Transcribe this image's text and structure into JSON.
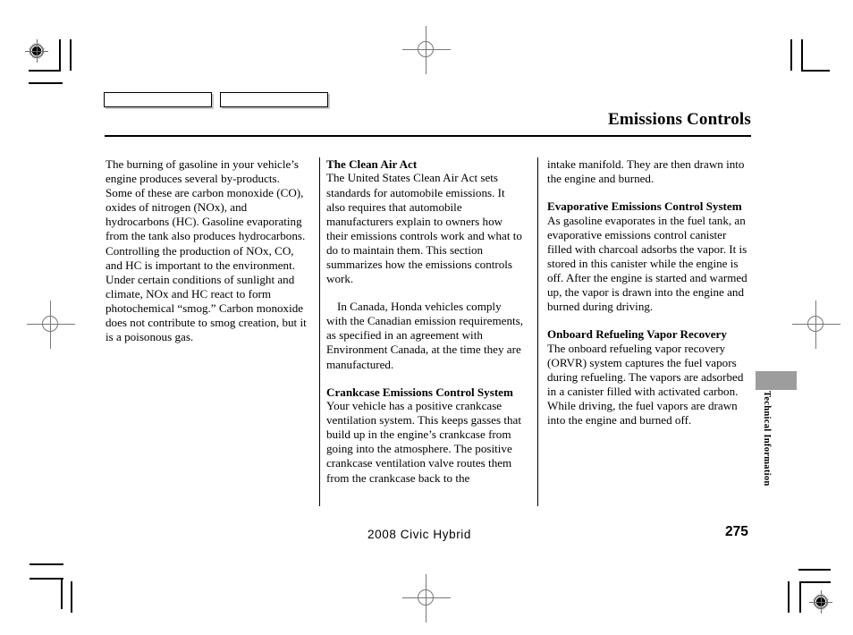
{
  "page": {
    "title": "Emissions Controls",
    "section_tab": "Technical Information",
    "footer_model": "2008  Civic  Hybrid",
    "footer_page_number": "275"
  },
  "tabs": [
    {
      "label": ""
    },
    {
      "label": ""
    }
  ],
  "columns": {
    "col1": {
      "body": "The burning of gasoline in your vehicle’s engine produces several by-products. Some of these are carbon monoxide (CO), oxides of nitrogen (NOx), and hydrocarbons (HC). Gasoline evaporating from the tank also produces hydrocarbons. Controlling the production of NOx, CO, and HC is important to the environment. Under certain conditions of sunlight and climate, NOx and HC react to form photochemical “smog.” Carbon monoxide does not contribute to smog creation, but it is a poisonous gas."
    },
    "col2": {
      "heading1": "The Clean Air Act",
      "body1": "The United States Clean Air Act sets standards for automobile emissions. It also requires that automobile manufacturers explain to owners how their emissions controls work and what to do to maintain them. This section summarizes how the emissions controls work.",
      "body2": "In Canada, Honda vehicles comply with the Canadian emission requirements, as specified in an agreement with Environment Canada, at the time they are manufactured.",
      "heading2": "Crankcase Emissions Control System",
      "body3": "Your vehicle has a positive crankcase ventilation system. This keeps gasses that build up in the engine’s crankcase from going into the atmosphere. The positive crankcase ventilation valve routes them from the crankcase back to the"
    },
    "col3": {
      "body1": "intake manifold. They are then drawn into the engine and burned.",
      "heading1": "Evaporative Emissions Control System",
      "body2": "As gasoline evaporates in the fuel tank, an evaporative emissions control canister filled with charcoal adsorbs the vapor. It is stored in this canister while the engine is off. After the engine is started and warmed up, the vapor is drawn into the engine and burned during driving.",
      "heading2": "Onboard Refueling Vapor Recovery",
      "body3": "The onboard refueling vapor recovery (ORVR) system captures the fuel vapors during refueling. The vapors are adsorbed in a canister filled with activated carbon. While driving, the fuel vapors are drawn into the engine and burned off."
    }
  },
  "colors": {
    "text": "#000000",
    "rule": "#000000",
    "section_tab_gray": "#9d9d9d",
    "registration_gray": "#777777",
    "tab_shadow": "#c9c9c9"
  }
}
